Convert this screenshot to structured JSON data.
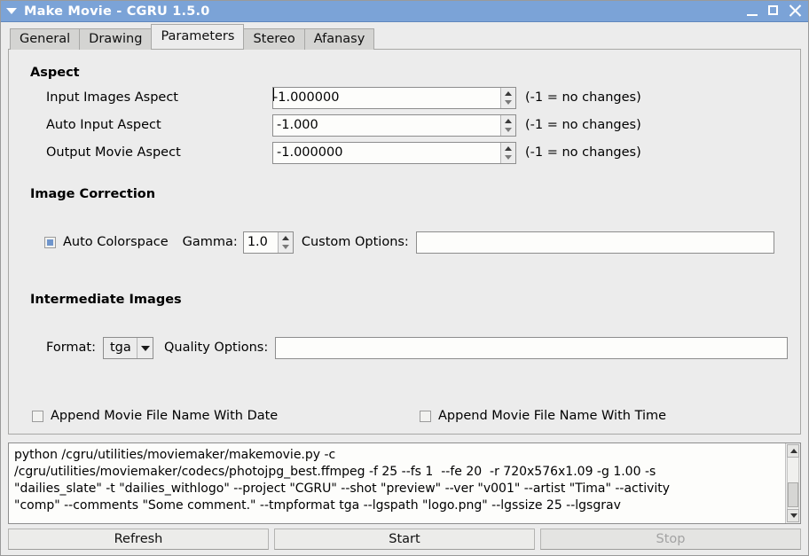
{
  "window": {
    "title": "Make Movie - CGRU 1.5.0",
    "menu_icon": "triangle-down-icon",
    "minimize_icon": "minimize-icon",
    "maximize_icon": "maximize-icon",
    "close_icon": "close-icon"
  },
  "tabs": [
    {
      "label": "General",
      "active": false
    },
    {
      "label": "Drawing",
      "active": false
    },
    {
      "label": "Parameters",
      "active": true
    },
    {
      "label": "Stereo",
      "active": false
    },
    {
      "label": "Afanasy",
      "active": false
    }
  ],
  "aspect": {
    "group_title": "Aspect",
    "rows": [
      {
        "label": "Input Images Aspect",
        "value": "-1.000000",
        "hint": "(-1 = no changes)",
        "focused": true
      },
      {
        "label": "Auto Input Aspect",
        "value": "-1.000",
        "hint": "(-1 = no changes)",
        "focused": false
      },
      {
        "label": "Output Movie Aspect",
        "value": "-1.000000",
        "hint": "(-1 = no changes)",
        "focused": false
      }
    ]
  },
  "image_correction": {
    "group_title": "Image Correction",
    "auto_colorspace_label": "Auto Colorspace",
    "auto_colorspace_state": "partial",
    "gamma_label": "Gamma:",
    "gamma_value": "1.0",
    "custom_options_label": "Custom Options:",
    "custom_options_value": ""
  },
  "intermediate_images": {
    "group_title": "Intermediate Images",
    "format_label": "Format:",
    "format_value": "tga",
    "quality_options_label": "Quality Options:",
    "quality_options_value": ""
  },
  "append_options": {
    "date_label": "Append Movie File Name With Date",
    "date_checked": false,
    "time_label": "Append Movie File Name With Time",
    "time_checked": false
  },
  "console": {
    "lines": [
      "python /cgru/utilities/moviemaker/makemovie.py -c",
      "/cgru/utilities/moviemaker/codecs/photojpg_best.ffmpeg -f 25 --fs 1  --fe 20  -r 720x576x1.09 -g 1.00 -s",
      "\"dailies_slate\" -t \"dailies_withlogo\" --project \"CGRU\" --shot \"preview\" --ver \"v001\" --artist \"Tima\" --activity",
      "\"comp\" --comments \"Some comment.\" --tmpformat tga --lgspath \"logo.png\" --lgssize 25 --lgsgrav"
    ],
    "scroll_up_icon": "arrow-up-icon",
    "scroll_down_icon": "arrow-down-icon"
  },
  "buttons": {
    "refresh": "Refresh",
    "start": "Start",
    "stop": "Stop",
    "stop_disabled": true
  },
  "colors": {
    "titlebar": "#7ba3d7",
    "window_bg": "#ececec",
    "field_bg": "#fdfdfb",
    "checkbox_fill": "#6f95cc",
    "disabled_text": "#a3a3a3"
  }
}
